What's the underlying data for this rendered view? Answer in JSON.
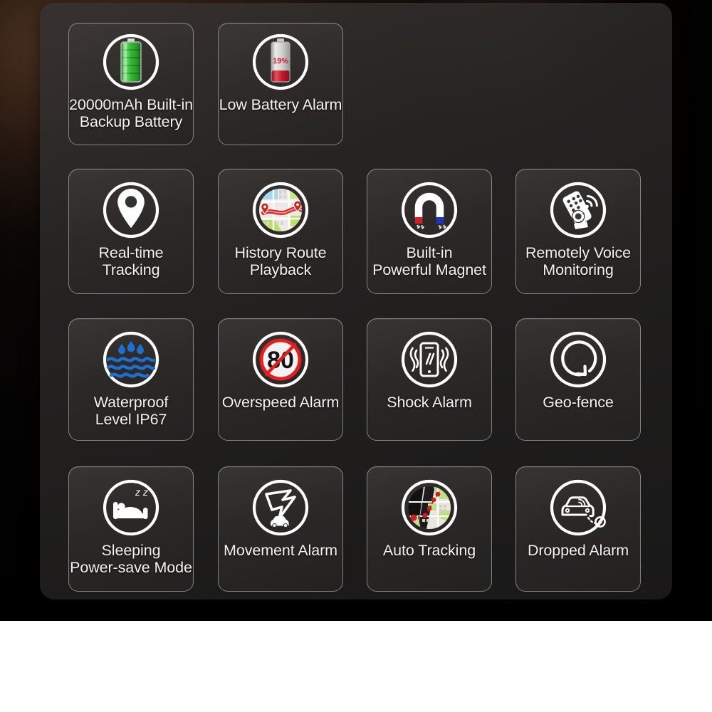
{
  "panel": {
    "background_color": "#2b2928",
    "tile_border_color": "#cdcdcd",
    "caption_color": "#f2f2f2"
  },
  "features": [
    {
      "id": "backup-battery",
      "icon": "battery-full-green-icon",
      "label": "20000mAh Built-in\nBackup Battery",
      "row": 1,
      "col": 1,
      "accent": "#3ec23e"
    },
    {
      "id": "low-battery-alarm",
      "icon": "battery-low-red-icon",
      "label": "Low Battery Alarm",
      "badge": "19%",
      "row": 1,
      "col": 2,
      "accent": "#d81f2a"
    },
    {
      "id": "real-time-tracking",
      "icon": "map-pin-icon",
      "label": "Real-time\nTracking",
      "row": 2,
      "col": 1,
      "accent": "#ffffff"
    },
    {
      "id": "history-route-playback",
      "icon": "route-map-icon",
      "label": "History Route\nPlayback",
      "row": 2,
      "col": 2,
      "accent": "#d42b2b"
    },
    {
      "id": "powerful-magnet",
      "icon": "horseshoe-magnet-icon",
      "label": "Built-in\nPowerful Magnet",
      "row": 2,
      "col": 3,
      "accent": "#d42020"
    },
    {
      "id": "remotely-voice-monitoring",
      "icon": "remote-control-signal-icon",
      "label": "Remotely Voice\nMonitoring",
      "row": 2,
      "col": 4,
      "accent": "#ffffff"
    },
    {
      "id": "waterproof",
      "icon": "water-drops-waves-icon",
      "label": "Waterproof\nLevel IP67",
      "row": 3,
      "col": 1,
      "accent": "#1d6fd0"
    },
    {
      "id": "overspeed-alarm",
      "icon": "speed-limit-80-crossed-icon",
      "label": "Overspeed Alarm",
      "badge": "80",
      "row": 3,
      "col": 2,
      "accent": "#e02020"
    },
    {
      "id": "shock-alarm",
      "icon": "phone-vibrate-icon",
      "label": "Shock Alarm",
      "row": 3,
      "col": 3,
      "accent": "#ffffff"
    },
    {
      "id": "geo-fence",
      "icon": "circular-arrow-fence-icon",
      "label": "Geo-fence",
      "row": 3,
      "col": 4,
      "accent": "#ffffff"
    },
    {
      "id": "sleeping-power-save",
      "icon": "bed-sleeping-zz-icon",
      "label": "Sleeping\nPower-save Mode",
      "badge": "z z",
      "row": 4,
      "col": 1,
      "accent": "#ffffff"
    },
    {
      "id": "movement-alarm",
      "icon": "lightning-bolt-car-icon",
      "label": "Movement Alarm",
      "row": 4,
      "col": 2,
      "accent": "#ffffff"
    },
    {
      "id": "auto-tracking",
      "icon": "map-trail-points-icon",
      "label": "Auto Tracking",
      "row": 4,
      "col": 3,
      "accent": "#d42b2b"
    },
    {
      "id": "dropped-alarm",
      "icon": "car-device-detached-icon",
      "label": "Dropped Alarm",
      "row": 4,
      "col": 4,
      "accent": "#ffffff"
    }
  ]
}
